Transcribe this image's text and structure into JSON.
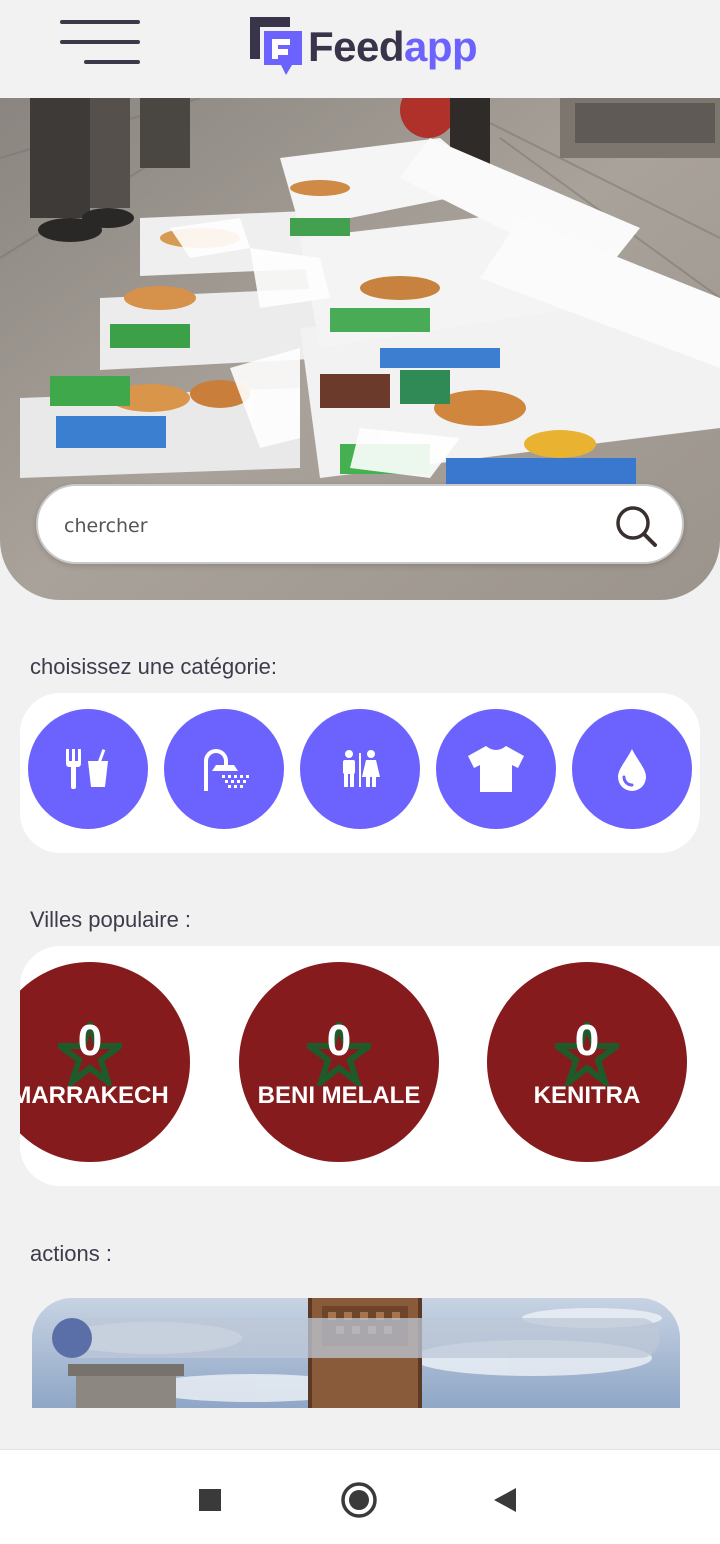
{
  "header": {
    "brand_part1": "Feed",
    "brand_part2": "app",
    "menu_icon": "hamburger-icon"
  },
  "search": {
    "placeholder": "chercher",
    "icon": "search-icon"
  },
  "categories": {
    "title": "choisissez une catégorie:",
    "items": [
      {
        "icon": "food-drink-icon"
      },
      {
        "icon": "shower-icon"
      },
      {
        "icon": "restroom-icon"
      },
      {
        "icon": "tshirt-icon"
      },
      {
        "icon": "water-drop-icon"
      }
    ]
  },
  "cities": {
    "title": "Villes populaire :",
    "items": [
      {
        "name": "MARRAKECH",
        "count": "0"
      },
      {
        "name": "BENI MELALE",
        "count": "0"
      },
      {
        "name": "KENITRA",
        "count": "0"
      }
    ]
  },
  "actions": {
    "title": "actions :"
  },
  "colors": {
    "accent": "#6c63ff",
    "city_red": "#861b1e",
    "star_green": "#1f5a2a",
    "brand_dark": "#39344a"
  },
  "navbar": {
    "icons": [
      "recent-apps-icon",
      "home-icon",
      "back-icon"
    ]
  }
}
